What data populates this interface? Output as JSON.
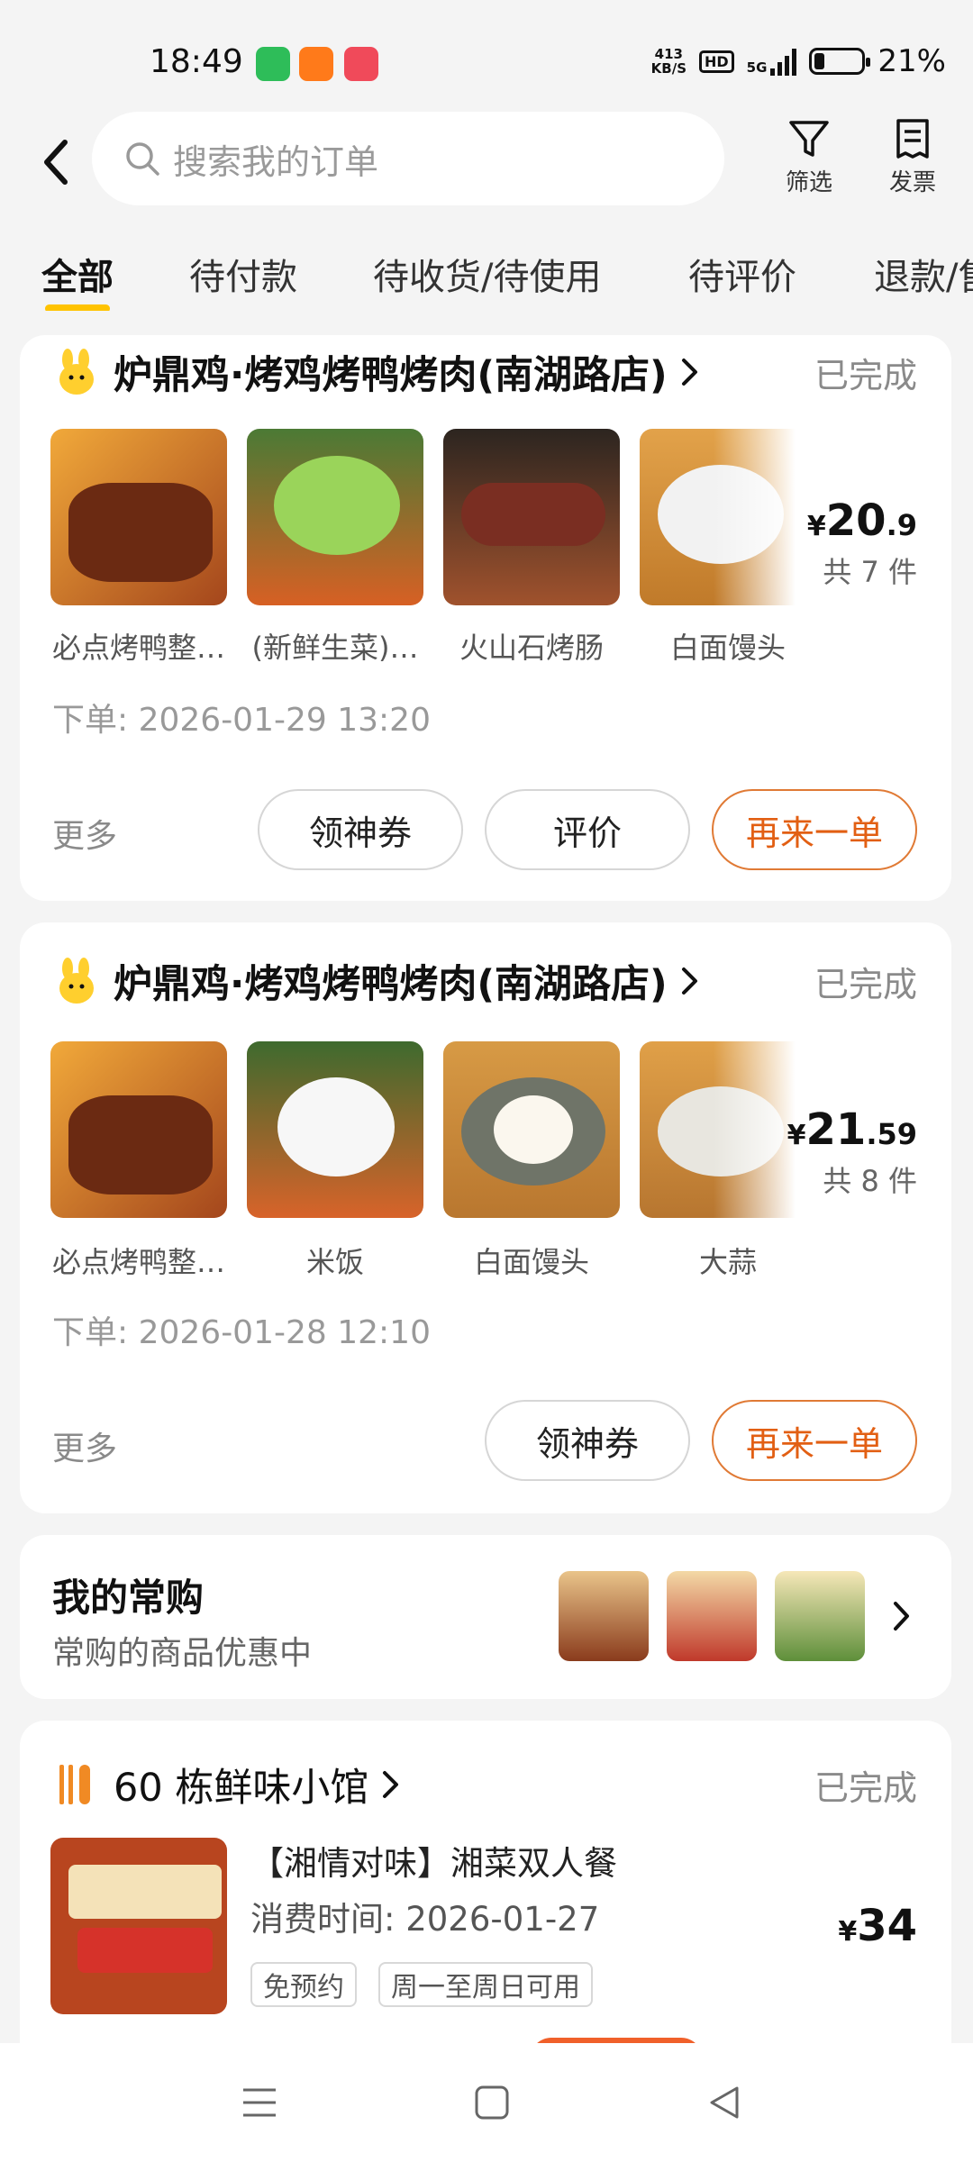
{
  "status_bar": {
    "time": "18:49",
    "net_speed": "413",
    "net_unit": "KB/S",
    "hd": "HD",
    "signal": "5G",
    "battery": "21%",
    "battery_level": 0.21
  },
  "header": {
    "search_placeholder": "搜索我的订单",
    "filter_label": "筛选",
    "invoice_label": "发票"
  },
  "tabs": [
    {
      "label": "全部",
      "active": true
    },
    {
      "label": "待付款"
    },
    {
      "label": "待收货/待使用"
    },
    {
      "label": "待评价"
    },
    {
      "label": "退款/售后"
    }
  ],
  "orders": [
    {
      "shop": "炉鼎鸡·烤鸡烤鸭烤肉(南湖路店)",
      "status": "已完成",
      "items": [
        "必点烤鸭整…",
        "(新鲜生菜)…",
        "火山石烤肠",
        "白面馒头"
      ],
      "price_int": "20",
      "price_dec": ".9",
      "count": "共 7 件",
      "order_time": "下单: 2026-01-29 13:20",
      "more": "更多",
      "buttons": [
        "领神券",
        "评价",
        "再来一单"
      ]
    },
    {
      "shop": "炉鼎鸡·烤鸡烤鸭烤肉(南湖路店)",
      "status": "已完成",
      "items": [
        "必点烤鸭整…",
        "米饭",
        "白面馒头",
        "大蒜"
      ],
      "price_int": "21",
      "price_dec": ".59",
      "count": "共 8 件",
      "order_time": "下单: 2026-01-28 12:10",
      "more": "更多",
      "buttons": [
        "领神券",
        "再来一单"
      ]
    }
  ],
  "favorites": {
    "title": "我的常购",
    "subtitle": "常购的商品优惠中"
  },
  "deal": {
    "shop": "60 栋鲜味小馆",
    "status": "已完成",
    "title": "【湘情对味】湘菜双人餐",
    "time": "消费时间: 2026-01-27",
    "price": "34",
    "tags": [
      "免预约",
      "周一至周日可用"
    ]
  },
  "colors": {
    "accent_orange": "#e25f13",
    "tab_underline": "#ffc300"
  }
}
